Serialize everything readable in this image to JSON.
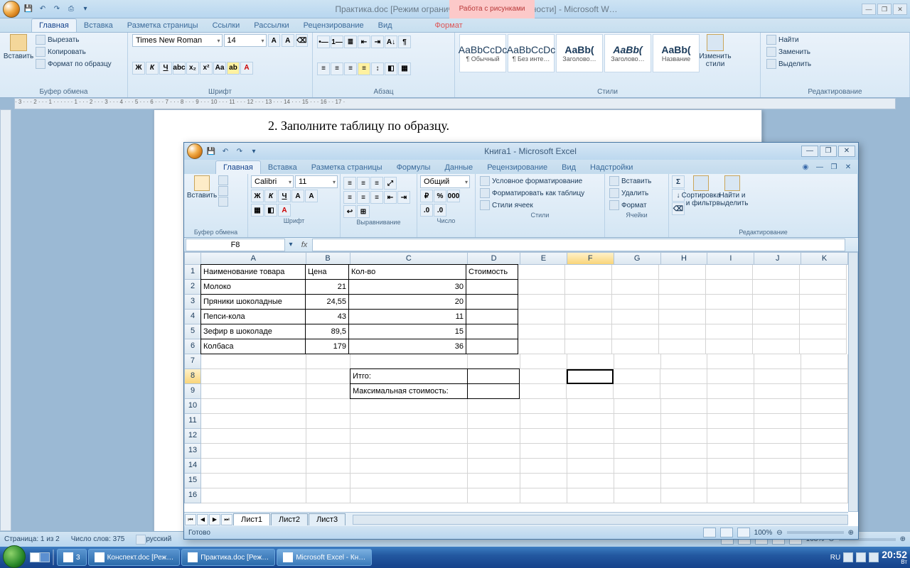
{
  "word": {
    "title": "Практика.doc [Режим ограниченной функциональности] - Microsoft W…",
    "context_header": "Работа с рисунками",
    "tabs": [
      "Главная",
      "Вставка",
      "Разметка страницы",
      "Ссылки",
      "Рассылки",
      "Рецензирование",
      "Вид"
    ],
    "context_tab": "Формат",
    "groups": {
      "clipboard": {
        "label": "Буфер обмена",
        "paste": "Вставить",
        "cut": "Вырезать",
        "copy": "Копировать",
        "fmt": "Формат по образцу"
      },
      "font": {
        "label": "Шрифт",
        "name": "Times New Roman",
        "size": "14"
      },
      "para": {
        "label": "Абзац"
      },
      "styles": {
        "label": "Стили",
        "change": "Изменить стили",
        "items": [
          {
            "preview": "AaBbCcDc",
            "name": "¶ Обычный"
          },
          {
            "preview": "AaBbCcDc",
            "name": "¶ Без инте…"
          },
          {
            "preview": "AaBb(",
            "name": "Заголово…"
          },
          {
            "preview": "AaBb(",
            "name": "Заголово…"
          },
          {
            "preview": "AaBb(",
            "name": "Название"
          }
        ]
      },
      "editing": {
        "label": "Редактирование",
        "find": "Найти",
        "replace": "Заменить",
        "select": "Выделить"
      }
    },
    "doc_text": "2.   Заполните таблицу по образцу.",
    "status": {
      "page": "Страница: 1 из 2",
      "words": "Число слов: 375",
      "lang": "русский",
      "zoom": "108%"
    }
  },
  "excel": {
    "title": "Книга1 - Microsoft Excel",
    "tabs": [
      "Главная",
      "Вставка",
      "Разметка страницы",
      "Формулы",
      "Данные",
      "Рецензирование",
      "Вид",
      "Надстройки"
    ],
    "groups": {
      "clipboard": {
        "label": "Буфер обмена",
        "paste": "Вставить"
      },
      "font": {
        "label": "Шрифт",
        "name": "Calibri",
        "size": "11"
      },
      "align": {
        "label": "Выравнивание"
      },
      "number": {
        "label": "Число",
        "fmt": "Общий"
      },
      "styles": {
        "label": "Стили",
        "cond": "Условное форматирование",
        "table": "Форматировать как таблицу",
        "cell": "Стили ячеек"
      },
      "cells": {
        "label": "Ячейки",
        "insert": "Вставить",
        "delete": "Удалить",
        "format": "Формат"
      },
      "editing": {
        "label": "Редактирование",
        "sort": "Сортировка и фильтр",
        "find": "Найти и выделить"
      }
    },
    "namebox": "F8",
    "cols": [
      "A",
      "B",
      "C",
      "D",
      "E",
      "F",
      "G",
      "H",
      "I",
      "J",
      "K"
    ],
    "table": {
      "headers": {
        "name": "Наименование товара",
        "price": "Цена",
        "qty": "Кол-во",
        "cost": "Стоимость"
      },
      "rows": [
        {
          "name": "Молоко",
          "price": "21",
          "qty": "30"
        },
        {
          "name": "Пряники шоколадные",
          "price": "24,55",
          "qty": "20"
        },
        {
          "name": "Пепси-кола",
          "price": "43",
          "qty": "11"
        },
        {
          "name": "Зефир в шоколаде",
          "price": "89,5",
          "qty": "15"
        },
        {
          "name": "Колбаса",
          "price": "179",
          "qty": "36"
        }
      ],
      "total_label": "Итго:",
      "max_label": "Максимальная стоимость:"
    },
    "sheets": [
      "Лист1",
      "Лист2",
      "Лист3"
    ],
    "status": {
      "ready": "Готово",
      "zoom": "100%"
    }
  },
  "taskbar": {
    "items": [
      "3",
      "Конспект.doc [Реж…",
      "Практика.doc [Реж…",
      "Microsoft Excel - Кн…"
    ],
    "lang": "RU",
    "time": "20:52",
    "day": "Вт"
  }
}
